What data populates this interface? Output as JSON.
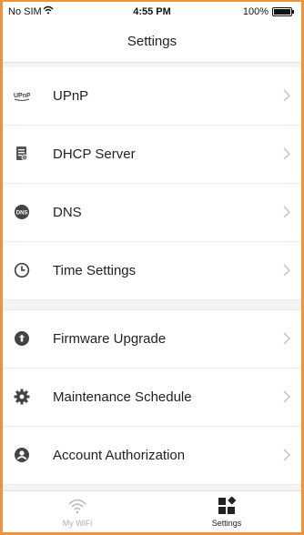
{
  "status_bar": {
    "carrier": "No SIM",
    "time": "4:55 PM",
    "battery": "100%"
  },
  "nav": {
    "title": "Settings"
  },
  "items": [
    {
      "label": "UPnP",
      "icon": "upnp-icon"
    },
    {
      "label": "DHCP Server",
      "icon": "dhcp-server-icon"
    },
    {
      "label": "DNS",
      "icon": "dns-icon"
    },
    {
      "label": "Time Settings",
      "icon": "clock-icon"
    },
    {
      "label": "Firmware Upgrade",
      "icon": "firmware-upgrade-icon"
    },
    {
      "label": "Maintenance Schedule",
      "icon": "gear-icon"
    },
    {
      "label": "Account Authorization",
      "icon": "account-icon"
    }
  ],
  "tabs": [
    {
      "label": "My WiFi",
      "icon": "wifi-icon"
    },
    {
      "label": "Settings",
      "icon": "settings-grid-icon"
    }
  ]
}
